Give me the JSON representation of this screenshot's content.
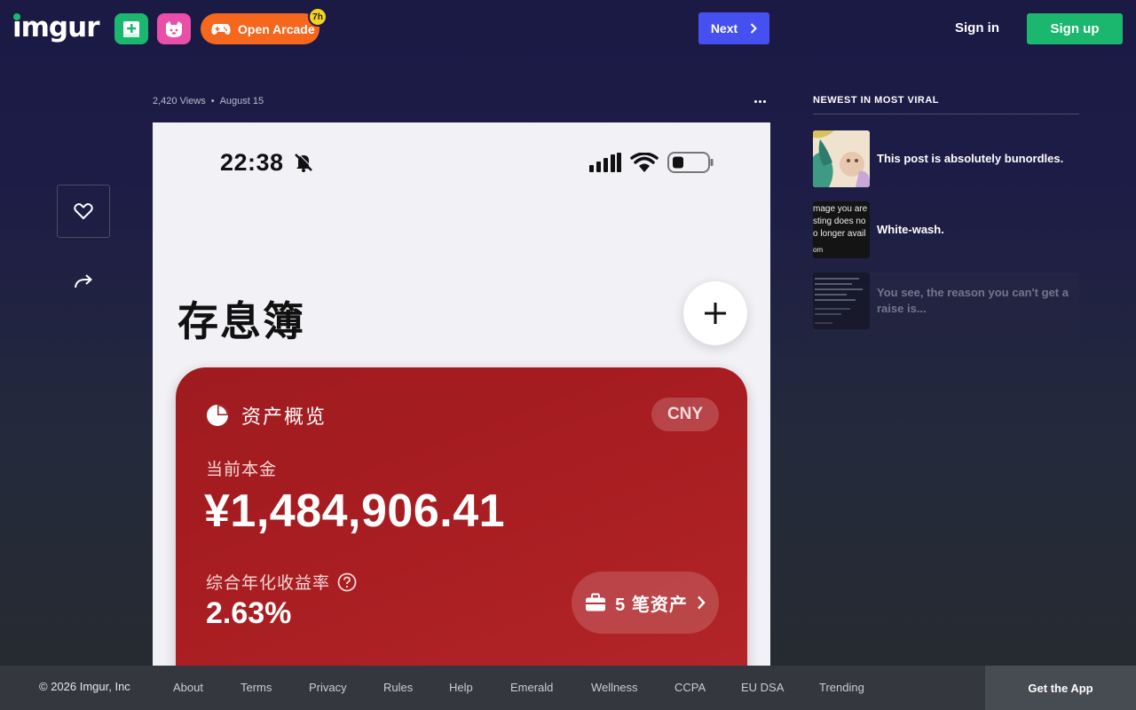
{
  "header": {
    "logo_text": "imgur",
    "arcade_label": "Open Arcade",
    "arcade_badge": "7h",
    "next_label": "Next",
    "signin_label": "Sign in",
    "signup_label": "Sign up",
    "colors": {
      "brand_green": "#1bb76e",
      "meme_pink": "#e94fa8",
      "arcade_orange": "#f6671e",
      "next_blue": "#4650f0"
    }
  },
  "post": {
    "views": "2,420 Views",
    "date": "August 15",
    "image": {
      "time": "22:38",
      "title": "存息簿",
      "card_heading": "资产概览",
      "currency": "CNY",
      "current_label": "当前本金",
      "current_value": "¥1,484,906.41",
      "rate_label": "综合年化收益率",
      "rate_value": "2.63%",
      "assets_label": "5 笔资产"
    }
  },
  "sidebar": {
    "title": "NEWEST IN MOST VIRAL",
    "items": [
      {
        "title": "This post is absolutely bunordles."
      },
      {
        "title": "White-wash.",
        "thumb_text": [
          "mage you are",
          "sting does no",
          "o longer avail",
          "",
          "om"
        ]
      },
      {
        "title": "You see, the reason you can't get a raise is..."
      }
    ]
  },
  "footer": {
    "copyright": "© 2026 Imgur, Inc",
    "links": [
      "About",
      "Terms",
      "Privacy",
      "Rules",
      "Help",
      "Emerald",
      "Wellness",
      "CCPA",
      "EU DSA",
      "Trending"
    ],
    "get_app": "Get the App"
  }
}
